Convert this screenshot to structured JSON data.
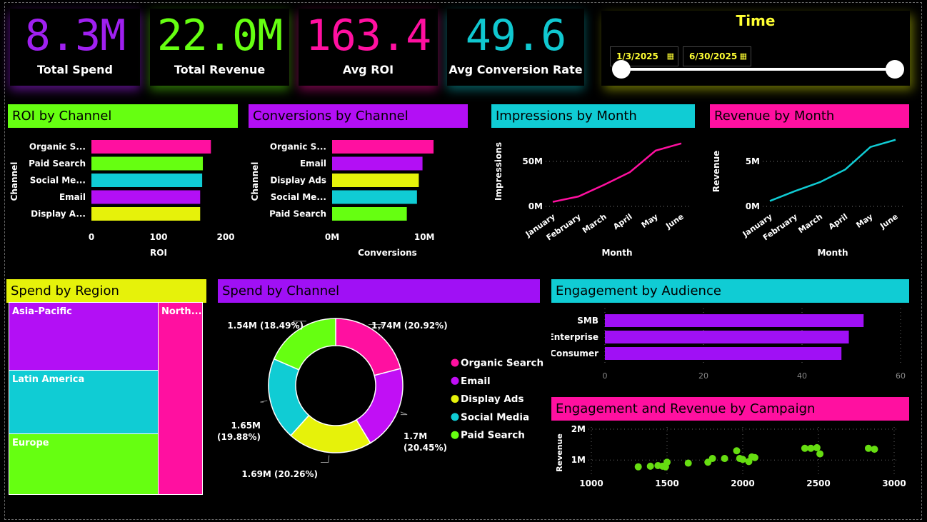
{
  "kpis": [
    {
      "value": "8.3M",
      "label": "Total Spend",
      "color": "#a020f0"
    },
    {
      "value": "22.0M",
      "label": "Total Revenue",
      "color": "#66ff11"
    },
    {
      "value": "163.4",
      "label": "Avg ROI",
      "color": "#ff10a0"
    },
    {
      "value": "49.6",
      "label": "Avg Conversion Rate",
      "color": "#10c8d0"
    }
  ],
  "time": {
    "title": "Time",
    "start": "1/3/2025",
    "end": "6/30/2025"
  },
  "colors": {
    "pink": "#ff10a0",
    "green": "#66ff11",
    "cyan": "#10ccd4",
    "purple": "#b30ff5",
    "yellow": "#e6f20a"
  },
  "titles": {
    "roi": "ROI by Channel",
    "conv": "Conversions by Channel",
    "imp": "Impressions by Month",
    "rev": "Revenue by Month",
    "region": "Spend by Region",
    "spend": "Spend by Channel",
    "eng": "Engagement by Audience",
    "camp": "Engagement and Revenue by Campaign"
  },
  "chart_data": [
    {
      "id": "roi",
      "type": "bar",
      "orientation": "horizontal",
      "categories": [
        "Organic S...",
        "Paid Search",
        "Social Me...",
        "Email",
        "Display A..."
      ],
      "values": [
        178,
        166,
        165,
        162,
        162
      ],
      "bar_colors": [
        "#ff10a0",
        "#66ff11",
        "#10ccd4",
        "#b30ff5",
        "#e6f20a"
      ],
      "xlabel": "ROI",
      "ylabel": "Channel",
      "xlim": [
        0,
        200
      ],
      "ticks": [
        0,
        100,
        200
      ],
      "tick_labels": [
        "0",
        "100",
        "200"
      ]
    },
    {
      "id": "conv",
      "type": "bar",
      "orientation": "horizontal",
      "categories": [
        "Organic S...",
        "Email",
        "Display Ads",
        "Social Me...",
        "Paid Search"
      ],
      "values": [
        11,
        9.8,
        9.4,
        9.2,
        8.1
      ],
      "bar_colors": [
        "#ff10a0",
        "#b30ff5",
        "#e6f20a",
        "#10ccd4",
        "#66ff11"
      ],
      "xlabel": "Conversions",
      "ylabel": "Channel",
      "xlim": [
        0,
        12
      ],
      "ticks": [
        0,
        10
      ],
      "tick_labels": [
        "0M",
        "10M"
      ]
    },
    {
      "id": "imp",
      "type": "line",
      "x": [
        "January",
        "February",
        "March",
        "April",
        "May",
        "June"
      ],
      "values": [
        5,
        11,
        24,
        38,
        62,
        70
      ],
      "color": "#ff10a0",
      "xlabel": "Month",
      "ylabel": "Impressions",
      "ylim": [
        0,
        75
      ],
      "ticks": [
        0,
        50
      ],
      "tick_labels": [
        "0M",
        "50M"
      ]
    },
    {
      "id": "rev",
      "type": "line",
      "x": [
        "January",
        "February",
        "March",
        "April",
        "May",
        "June"
      ],
      "values": [
        0.6,
        1.7,
        2.7,
        4.1,
        6.6,
        7.4
      ],
      "color": "#10ccd4",
      "xlabel": "Month",
      "ylabel": "Revenue",
      "ylim": [
        0,
        8
      ],
      "ticks": [
        0,
        5
      ],
      "tick_labels": [
        "0M",
        "5M"
      ]
    },
    {
      "id": "region",
      "type": "treemap",
      "items": [
        {
          "label": "Asia-Pacific",
          "color": "#b30ff5"
        },
        {
          "label": "Latin America",
          "color": "#10ccd4"
        },
        {
          "label": "Europe",
          "color": "#66ff11"
        },
        {
          "label": "North...",
          "color": "#ff10a0"
        }
      ]
    },
    {
      "id": "spend",
      "type": "pie",
      "donut": true,
      "slices": [
        {
          "name": "Organic Search",
          "value": 1.74,
          "label": "1.74M (20.92%)",
          "color": "#ff10a0"
        },
        {
          "name": "Email",
          "value": 1.7,
          "label": "1.7M (20.45%)",
          "color": "#c10ff5"
        },
        {
          "name": "Display Ads",
          "value": 1.69,
          "label": "1.69M (20.26%)",
          "color": "#e6f20a"
        },
        {
          "name": "Social Media",
          "value": 1.65,
          "label": "1.65M (19.88%)",
          "color": "#10ccd4"
        },
        {
          "name": "Paid Search",
          "value": 1.54,
          "label": "1.54M (18.49%)",
          "color": "#66ff11"
        }
      ],
      "legend": "right"
    },
    {
      "id": "eng",
      "type": "bar",
      "orientation": "horizontal",
      "categories": [
        "SMB",
        "Enterprise",
        "Consumer"
      ],
      "values": [
        52.5,
        49.5,
        48
      ],
      "color": "#a010f5",
      "xlim": [
        0,
        60
      ],
      "ticks": [
        0,
        20,
        40,
        60
      ],
      "tick_labels": [
        "0",
        "20",
        "40",
        "60"
      ]
    },
    {
      "id": "camp",
      "type": "scatter",
      "color": "#66dd11",
      "ylabel": "Revenue",
      "xlim": [
        1000,
        3000
      ],
      "x_ticks": [
        1000,
        1500,
        2000,
        2500,
        3000
      ],
      "ylim": [
        0.6,
        2.0
      ],
      "y_ticks": [
        1,
        2
      ],
      "y_tick_labels": [
        "1M",
        "2M"
      ],
      "points": [
        [
          1310,
          0.78
        ],
        [
          1390,
          0.8
        ],
        [
          1440,
          0.82
        ],
        [
          1470,
          0.8
        ],
        [
          1490,
          0.78
        ],
        [
          1500,
          0.93
        ],
        [
          1640,
          0.9
        ],
        [
          1770,
          0.93
        ],
        [
          1800,
          1.05
        ],
        [
          1880,
          1.05
        ],
        [
          1960,
          1.3
        ],
        [
          1980,
          1.05
        ],
        [
          2000,
          1.02
        ],
        [
          2040,
          0.95
        ],
        [
          2060,
          1.1
        ],
        [
          2080,
          1.08
        ],
        [
          2410,
          1.38
        ],
        [
          2450,
          1.38
        ],
        [
          2490,
          1.4
        ],
        [
          2510,
          1.2
        ],
        [
          2830,
          1.38
        ],
        [
          2870,
          1.35
        ]
      ]
    }
  ]
}
